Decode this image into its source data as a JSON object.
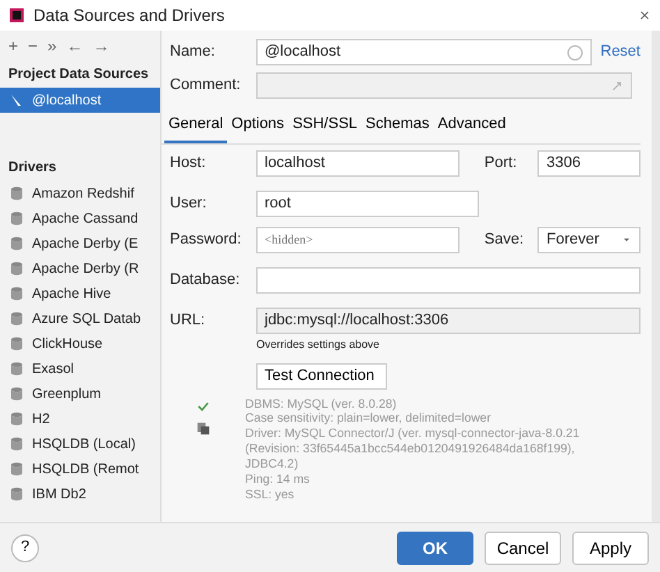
{
  "window": {
    "title": "Data Sources and Drivers"
  },
  "toolbar": [
    "+",
    "−",
    "»",
    "←",
    "→"
  ],
  "sidebar": {
    "project_heading": "Project Data Sources",
    "project_items": [
      {
        "label": "@localhost",
        "selected": true
      }
    ],
    "drivers_heading": "Drivers",
    "drivers": [
      "Amazon Redshif",
      "Apache Cassand",
      "Apache Derby (E",
      "Apache Derby (R",
      "Apache Hive",
      "Azure SQL Datab",
      "ClickHouse",
      "Exasol",
      "Greenplum",
      "H2",
      "HSQLDB (Local)",
      "HSQLDB (Remot",
      "IBM Db2"
    ]
  },
  "name": {
    "label": "Name:",
    "value": "@localhost",
    "reset": "Reset"
  },
  "comment": {
    "label": "Comment:"
  },
  "tabs": [
    {
      "label": "General",
      "selected": true
    },
    {
      "label": "Options",
      "selected": false
    },
    {
      "label": "SSH/SSL",
      "selected": false
    },
    {
      "label": "Schemas",
      "selected": false
    },
    {
      "label": "Advanced",
      "selected": false
    }
  ],
  "general": {
    "host_label": "Host:",
    "host": "localhost",
    "port_label": "Port:",
    "port": "3306",
    "user_label": "User:",
    "user": "root",
    "password_label": "Password:",
    "password_placeholder": "<hidden>",
    "save_label": "Save:",
    "save": "Forever",
    "database_label": "Database:",
    "url_label": "URL:",
    "url": "jdbc:mysql://localhost:3306",
    "url_hint": "Overrides settings above",
    "test_button": "Test Connection",
    "result": [
      "DBMS: MySQL (ver. 8.0.28)",
      "Case sensitivity: plain=lower, delimited=lower",
      "Driver: MySQL Connector/J (ver. mysql-connector-java-8.0.21 (Revision: 33f65445a1bcc544eb0120491926484da168f199), JDBC4.2)",
      "Ping: 14 ms",
      "SSL: yes"
    ]
  },
  "footer": {
    "help": "?",
    "buttons": [
      {
        "label": "OK",
        "kind": "primary"
      },
      {
        "label": "Cancel",
        "kind": "default"
      },
      {
        "label": "Apply",
        "kind": "default"
      }
    ]
  }
}
